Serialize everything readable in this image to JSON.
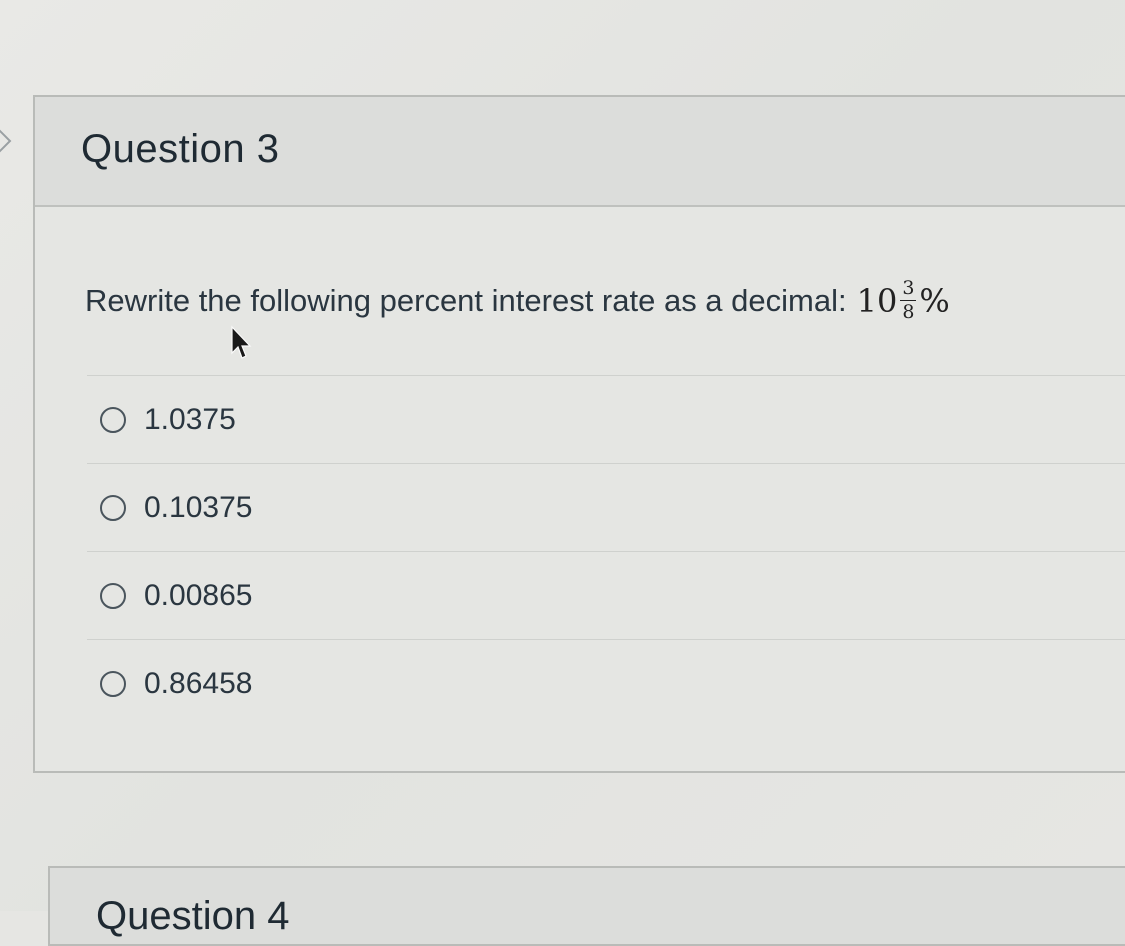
{
  "question": {
    "title": "Question 3",
    "prompt": "Rewrite the following percent interest rate as a decimal:",
    "rate": {
      "whole": "10",
      "numerator": "3",
      "denominator": "8",
      "unit": "%"
    },
    "options": [
      {
        "label": "1.0375",
        "selected": false
      },
      {
        "label": "0.10375",
        "selected": false
      },
      {
        "label": "0.00865",
        "selected": false
      },
      {
        "label": "0.86458",
        "selected": false
      }
    ]
  },
  "next_question": {
    "title": "Question 4"
  },
  "icons": {
    "nav": "chevron-right-icon",
    "pointer": "mouse-pointer-icon",
    "radio": "radio-button-icon"
  },
  "colors": {
    "background": "#e6e6e3",
    "header": "#dcdddb",
    "text": "#2a3640",
    "border": "#b9bbb8"
  }
}
